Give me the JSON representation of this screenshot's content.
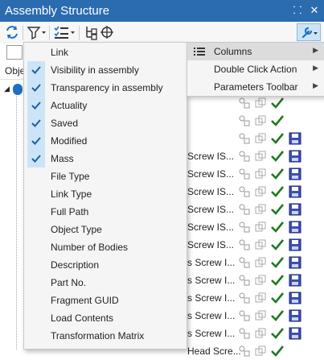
{
  "window": {
    "title": "Assembly Structure",
    "pin_glyph": "⸬",
    "close_glyph": "✕"
  },
  "toolbar": {
    "buttons": [
      {
        "name": "refresh-icon"
      },
      {
        "name": "filter-icon"
      },
      {
        "name": "checklist-icon"
      },
      {
        "name": "tree-structure-icon"
      },
      {
        "name": "target-icon"
      },
      {
        "name": "wrench-icon"
      }
    ]
  },
  "tree": {
    "header": "Obje"
  },
  "columns_menu": {
    "items": [
      {
        "label": "Link",
        "checked": false
      },
      {
        "label": "Visibility in assembly",
        "checked": true
      },
      {
        "label": "Transparency in assembly",
        "checked": true
      },
      {
        "label": "Actuality",
        "checked": true
      },
      {
        "label": "Saved",
        "checked": true
      },
      {
        "label": "Modified",
        "checked": true
      },
      {
        "label": "Mass",
        "checked": true
      },
      {
        "label": "File Type",
        "checked": false
      },
      {
        "label": "Link Type",
        "checked": false
      },
      {
        "label": "Full Path",
        "checked": false
      },
      {
        "label": "Object Type",
        "checked": false
      },
      {
        "label": "Number of Bodies",
        "checked": false
      },
      {
        "label": "Description",
        "checked": false
      },
      {
        "label": "Part No.",
        "checked": false
      },
      {
        "label": "Fragment GUID",
        "checked": false
      },
      {
        "label": "Load Contents",
        "checked": false
      },
      {
        "label": "Transformation Matrix",
        "checked": false
      }
    ]
  },
  "settings_menu": {
    "items": [
      {
        "label": "Columns",
        "arrow": "▶",
        "highlighted": true
      },
      {
        "label": "Double Click Action",
        "arrow": "▶",
        "highlighted": false
      },
      {
        "label": "Parameters Toolbar",
        "arrow": "▶",
        "highlighted": false
      }
    ]
  },
  "rows": [
    {
      "text": "",
      "saved": false
    },
    {
      "text": "",
      "saved": false
    },
    {
      "text": "",
      "saved": true
    },
    {
      "text": "Screw IS...",
      "saved": true
    },
    {
      "text": "Screw IS...",
      "saved": true
    },
    {
      "text": "Screw IS...",
      "saved": true
    },
    {
      "text": "Screw IS...",
      "saved": true
    },
    {
      "text": "Screw IS...",
      "saved": true
    },
    {
      "text": "Screw IS...",
      "saved": true
    },
    {
      "text": "s Screw I...",
      "saved": true
    },
    {
      "text": "s Screw I...",
      "saved": true
    },
    {
      "text": "s Screw I...",
      "saved": true
    },
    {
      "text": "s Screw I...",
      "saved": true
    },
    {
      "text": "s Screw I...",
      "saved": true
    },
    {
      "text": "Head Scre...",
      "saved": false
    }
  ],
  "colors": {
    "title_bg": "#2b6cb0",
    "check": "#1e7a1e",
    "menu_check_bg": "#cce4f7"
  }
}
